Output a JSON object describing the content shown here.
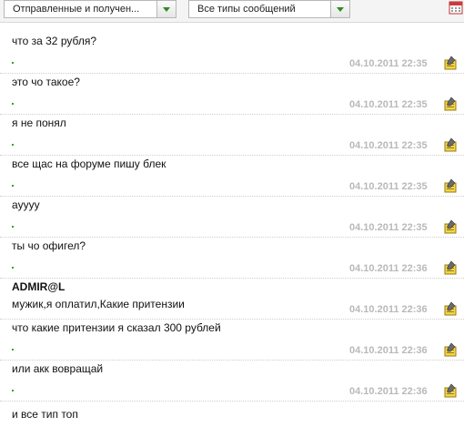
{
  "toolbar": {
    "filter_direction": "Отправленные и получен...",
    "filter_type": "Все типы сообщений"
  },
  "messages": [
    {
      "text": "что за 32 рубля?",
      "time": "04.10.2011 22:35"
    },
    {
      "text": "это чо такое?",
      "time": "04.10.2011 22:35"
    },
    {
      "text": "я не понял",
      "time": "04.10.2011 22:35"
    },
    {
      "text": "все щас на форуме пишу блек",
      "time": "04.10.2011 22:35"
    },
    {
      "text": "ayyyy",
      "time": "04.10.2011 22:35"
    },
    {
      "text": "ты чо офигел?",
      "time": "04.10.2011 22:36"
    },
    {
      "sender": "ADMIR@L",
      "text": "мужик,я оплатил,Какие притензии",
      "time": "04.10.2011 22:36"
    },
    {
      "text": "что какие притензии я сказал 300 рублей",
      "time": "04.10.2011 22:36"
    },
    {
      "text": "или акк вовращай",
      "time": "04.10.2011 22:36"
    }
  ],
  "last_message": {
    "text": "и все тип топ"
  },
  "icons": {
    "calendar": "calendar-icon",
    "edit": "edit-note-icon"
  },
  "colors": {
    "timestamp": "#b9b9b9",
    "accent_green": "#2e8b1e"
  }
}
